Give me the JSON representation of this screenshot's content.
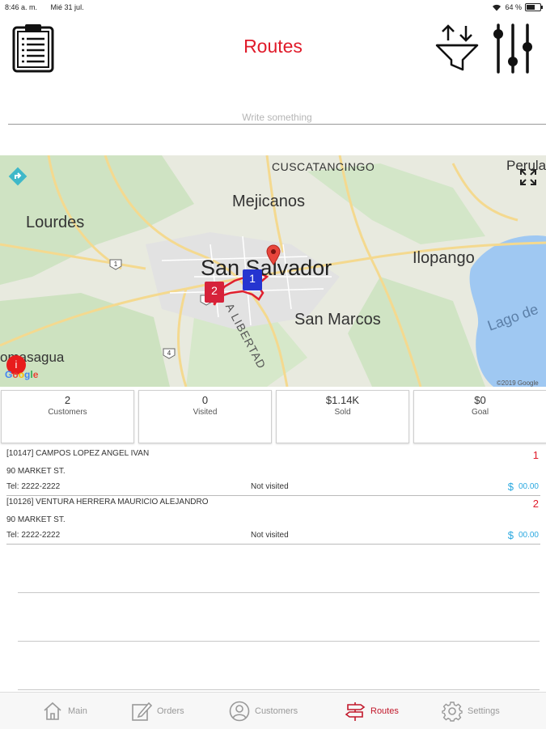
{
  "status_bar": {
    "time": "8:46 a. m.",
    "date": "Mié 31 jul.",
    "battery": "64 %",
    "battery_level": 0.64
  },
  "header": {
    "title": "Routes"
  },
  "search": {
    "placeholder": "Write something"
  },
  "map": {
    "labels": {
      "cuscatancingo": "CUSCATANCINGO",
      "perula": "Perula",
      "mejicanos": "Mejicanos",
      "lourdes": "Lourdes",
      "san_salvador": "San Salvador",
      "ilopango": "Ilopango",
      "san_marcos": "San Marcos",
      "lago": "Lago de",
      "la_libertad": "A LIBERTAD",
      "comasagua": "omasagua",
      "shield_1a": "1",
      "shield_1b": "1",
      "shield_4": "4",
      "copyright": "©2019 Google"
    },
    "google_logo": [
      "G",
      "o",
      "o",
      "g",
      "l",
      "e"
    ],
    "markers": {
      "first": "1",
      "second": "2",
      "info": "i"
    },
    "colors": {
      "route": "#e0202e",
      "marker_blue": "#2535d0",
      "marker_red": "#d6223a",
      "water": "#9fc8f2",
      "land": "#e8eadf"
    }
  },
  "stats": [
    {
      "value": "2",
      "label": "Customers"
    },
    {
      "value": "0",
      "label": "Visited"
    },
    {
      "value": "$1.14K",
      "label": "Sold"
    },
    {
      "value": "$0",
      "label": "Goal"
    }
  ],
  "customers": [
    {
      "name": "[10147] CAMPOS LOPEZ ANGEL IVAN",
      "number": "1",
      "address": "90 MARKET ST.",
      "tel": "Tel: 2222-2222",
      "status": "Not visited",
      "currency": "$",
      "amount": "00.00"
    },
    {
      "name": "[10126] VENTURA HERRERA MAURICIO ALEJANDRO",
      "number": "2",
      "address": "90 MARKET ST.",
      "tel": "Tel: 2222-2222",
      "status": "Not visited",
      "currency": "$",
      "amount": "00.00"
    }
  ],
  "tabs": [
    {
      "label": "Main",
      "icon": "home-icon"
    },
    {
      "label": "Orders",
      "icon": "edit-icon"
    },
    {
      "label": "Customers",
      "icon": "user-icon"
    },
    {
      "label": "Routes",
      "icon": "signpost-icon",
      "active": true
    },
    {
      "label": "Settings",
      "icon": "gear-icon"
    }
  ],
  "colors": {
    "accent": "#e01b2a",
    "amount": "#29a8e0",
    "tab_inactive": "#999999"
  }
}
